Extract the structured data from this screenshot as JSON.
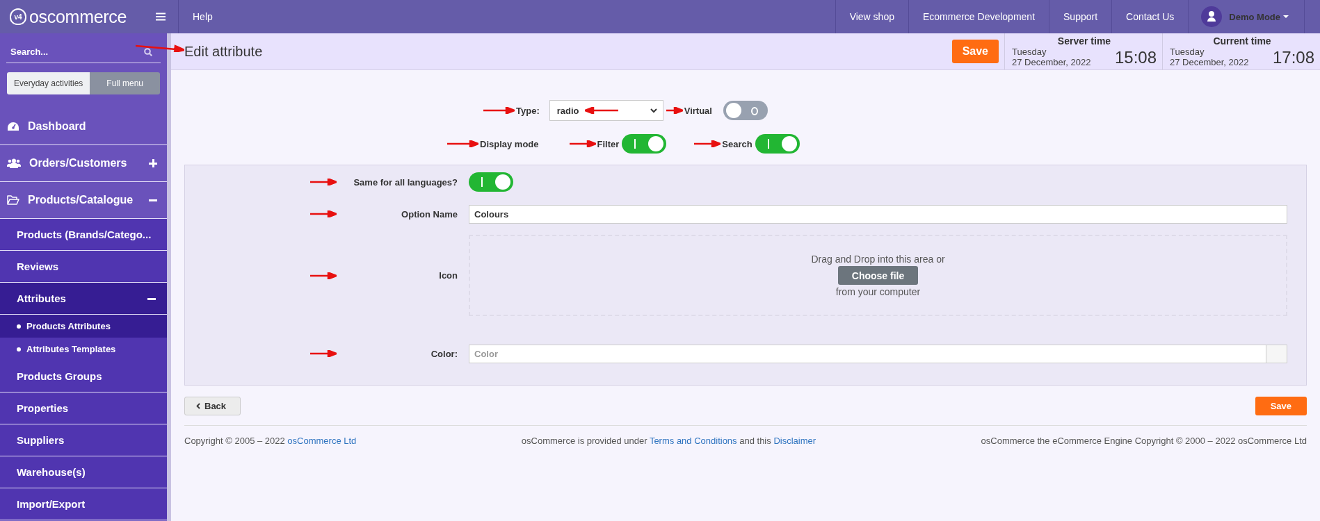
{
  "topbar": {
    "logo_badge": "v4",
    "logo_text": "oscommerce",
    "menu": [
      "Help"
    ],
    "links": [
      "View shop",
      "Ecommerce Development",
      "Support",
      "Contact Us"
    ],
    "user": "Demo Mode"
  },
  "sidebar": {
    "search": {
      "placeholder": "Search..."
    },
    "mode_tabs": [
      {
        "label": "Everyday activities",
        "selected": false
      },
      {
        "label": "Full menu",
        "selected": true
      }
    ],
    "items": [
      {
        "label": "Dashboard",
        "selected": false
      },
      {
        "label": "Orders/Customers",
        "selected": false,
        "expanded": false
      },
      {
        "label": "Products/Catalogue",
        "selected": false,
        "expanded": true,
        "children": [
          {
            "label": "Products (Brands/Catego...",
            "selected": false
          },
          {
            "label": "Reviews",
            "selected": false
          },
          {
            "label": "Attributes",
            "selected": true,
            "expanded": true,
            "children": [
              {
                "label": "Products Attributes",
                "selected": true
              },
              {
                "label": "Attributes Templates",
                "selected": false
              }
            ]
          },
          {
            "label": "Products Groups",
            "selected": false
          },
          {
            "label": "Properties",
            "selected": false
          },
          {
            "label": "Suppliers",
            "selected": false
          },
          {
            "label": "Warehouse(s)",
            "selected": false
          },
          {
            "label": "Import/Export",
            "selected": false
          }
        ]
      }
    ]
  },
  "header": {
    "title": "Edit attribute",
    "save": "Save",
    "clocks": [
      {
        "label": "Server time",
        "day": "Tuesday",
        "date": "27 December, 2022",
        "time": "15:08"
      },
      {
        "label": "Current time",
        "day": "Tuesday",
        "date": "27 December, 2022",
        "time": "17:08"
      }
    ]
  },
  "form": {
    "type": {
      "label": "Type:",
      "value": "radio"
    },
    "virtual": {
      "label": "Virtual",
      "on": false
    },
    "display_mode": {
      "label": "Display mode",
      "toggles": [
        {
          "label": "Filter",
          "on": true
        },
        {
          "label": "Search",
          "on": true
        }
      ]
    },
    "same_for_all": {
      "label": "Same for all languages?",
      "on": true
    },
    "option_name": {
      "label": "Option Name",
      "value": "Colours"
    },
    "icon": {
      "label": "Icon",
      "drop_text": "Drag and Drop into this area or",
      "button": "Choose file",
      "drop_subtext": "from your computer"
    },
    "color": {
      "label": "Color:",
      "placeholder": "Color"
    }
  },
  "actions": {
    "back": "Back",
    "save": "Save"
  },
  "footer": [
    [
      {
        "text": "Copyright © 2005 – 2022 "
      },
      {
        "link": "osCommerce Ltd"
      }
    ],
    [
      {
        "text": "osCommerce is provided under "
      },
      {
        "link": "Terms and Conditions"
      },
      {
        "text": " and this "
      },
      {
        "link": "Disclaimer"
      }
    ],
    [
      {
        "text": "osCommerce the eCommerce Engine Copyright © 2000 – 2022 osCommerce Ltd"
      }
    ]
  ]
}
